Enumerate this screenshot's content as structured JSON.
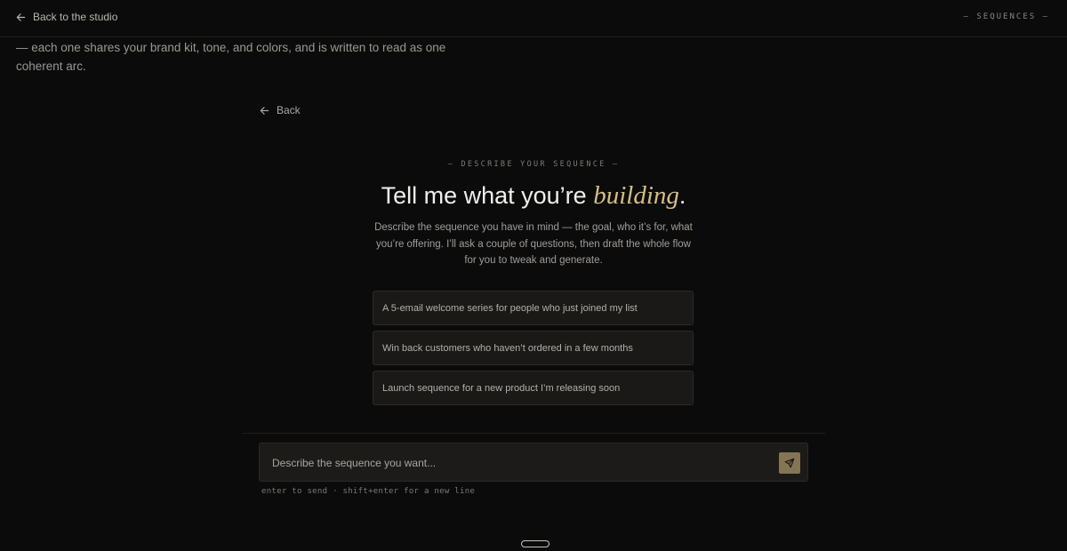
{
  "topbar": {
    "back_label": "Back to the studio",
    "section_label": "— SEQUENCES —"
  },
  "background": {
    "intro_text": "— each one shares your brand kit, tone, and colors, and is written to read as one coherent arc."
  },
  "nav": {
    "back_label": "Back"
  },
  "hero": {
    "eyebrow": "— DESCRIBE YOUR SEQUENCE —",
    "headline_prefix": "Tell me what you’re ",
    "headline_accent": "building",
    "headline_suffix": ".",
    "subtitle": "Describe the sequence you have in mind — the goal, who it’s for, what you’re offering. I’ll ask a couple of questions, then draft the whole flow for you to tweak and generate."
  },
  "suggestions": [
    {
      "label": "A 5-email welcome series for people who just joined my list"
    },
    {
      "label": "Win back customers who haven’t ordered in a few months"
    },
    {
      "label": "Launch sequence for a new product I’m releasing soon"
    }
  ],
  "composer": {
    "placeholder": "Describe the sequence you want...",
    "value": "",
    "hint": "enter to send · shift+enter for a new line",
    "send_icon": "send-icon"
  },
  "colors": {
    "background": "#0b0b0b",
    "accent": "#d6bd86",
    "send_button": "#857554"
  }
}
